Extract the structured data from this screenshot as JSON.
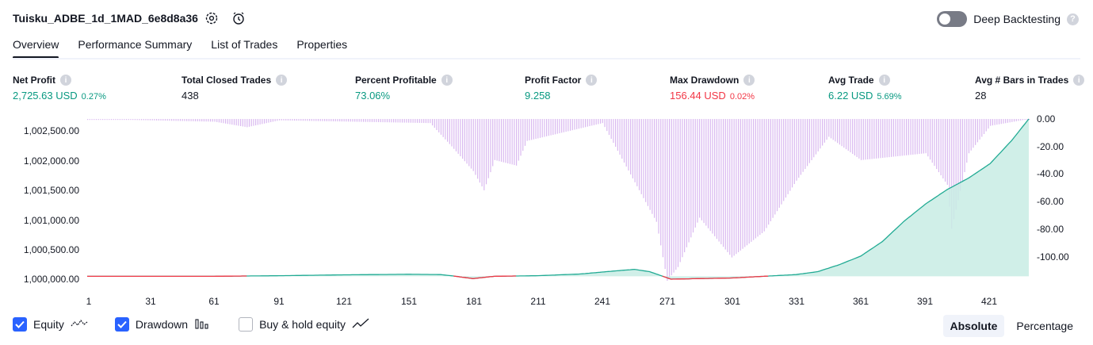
{
  "header": {
    "strategy_name": "Tuisku_ADBE_1d_1MAD_6e8d8a36",
    "deep_backtesting_label": "Deep Backtesting",
    "deep_backtesting_enabled": false
  },
  "tabs": [
    {
      "label": "Overview",
      "active": true
    },
    {
      "label": "Performance Summary",
      "active": false
    },
    {
      "label": "List of Trades",
      "active": false
    },
    {
      "label": "Properties",
      "active": false
    }
  ],
  "metrics": [
    {
      "label": "Net Profit",
      "value": "2,725.63 USD",
      "pct": "0.27%",
      "color": "green"
    },
    {
      "label": "Total Closed Trades",
      "value": "438",
      "pct": "",
      "color": "dark"
    },
    {
      "label": "Percent Profitable",
      "value": "73.06%",
      "pct": "",
      "color": "green"
    },
    {
      "label": "Profit Factor",
      "value": "9.258",
      "pct": "",
      "color": "green"
    },
    {
      "label": "Max Drawdown",
      "value": "156.44 USD",
      "pct": "0.02%",
      "color": "red"
    },
    {
      "label": "Avg Trade",
      "value": "6.22 USD",
      "pct": "5.69%",
      "color": "green"
    },
    {
      "label": "Avg # Bars in Trades",
      "value": "28",
      "pct": "",
      "color": "dark"
    }
  ],
  "chart": {
    "left_axis_labels": [
      "1,002,500.00",
      "1,002,000.00",
      "1,001,500.00",
      "1,001,000.00",
      "1,000,500.00",
      "1,000,000.00"
    ],
    "right_axis_labels": [
      "0.00",
      "-20.00",
      "-40.00",
      "-60.00",
      "-80.00",
      "-100.00"
    ],
    "x_axis_labels": [
      "1",
      "31",
      "61",
      "91",
      "121",
      "151",
      "181",
      "211",
      "241",
      "271",
      "301",
      "331",
      "361",
      "391",
      "421"
    ]
  },
  "chart_data": {
    "type": "area",
    "equity_series": {
      "name": "Equity",
      "x": [
        1,
        30,
        60,
        90,
        120,
        150,
        165,
        172,
        180,
        190,
        210,
        230,
        245,
        255,
        262,
        272,
        285,
        300,
        315,
        330,
        340,
        350,
        360,
        370,
        380,
        390,
        400,
        410,
        420,
        430,
        438
      ],
      "y": [
        1000000,
        1000000,
        1000000,
        1000010,
        1000025,
        1000035,
        1000030,
        1000000,
        999960,
        1000000,
        1000010,
        1000040,
        1000090,
        1000120,
        1000080,
        999950,
        999960,
        999970,
        1000000,
        1000030,
        1000080,
        1000200,
        1000350,
        1000600,
        1000950,
        1001250,
        1001500,
        1001700,
        1001950,
        1002350,
        1002725
      ]
    },
    "drawdown_series": {
      "name": "Drawdown",
      "x": [
        1,
        60,
        75,
        90,
        160,
        170,
        180,
        185,
        190,
        200,
        205,
        240,
        265,
        270,
        275,
        285,
        300,
        315,
        330,
        345,
        360,
        390,
        400,
        402,
        410,
        420,
        438
      ],
      "y": [
        0,
        -2,
        -6,
        -1,
        -3,
        -20,
        -38,
        -52,
        -30,
        -34,
        -16,
        -3,
        -75,
        -118,
        -108,
        -72,
        -101,
        -82,
        -45,
        -13,
        -30,
        -25,
        -48,
        -80,
        -25,
        -5,
        0
      ]
    },
    "left_ylim": [
      999950,
      1002725
    ],
    "right_ylim": [
      -118,
      0
    ],
    "xlim": [
      1,
      438
    ]
  },
  "legend": [
    {
      "label": "Equity",
      "checked": true,
      "icon": "equity-line-icon"
    },
    {
      "label": "Drawdown",
      "checked": true,
      "icon": "drawdown-bars-icon"
    },
    {
      "label": "Buy & hold equity",
      "checked": false,
      "icon": "buyhold-line-icon"
    }
  ],
  "scale_toggle": {
    "absolute": "Absolute",
    "percentage": "Percentage",
    "selected": "Absolute"
  },
  "colors": {
    "equity_line": "#22ab94",
    "equity_fill": "#c8ece4",
    "equity_below_line": "#f23645",
    "drawdown_bar": "#d9b8f0",
    "accent": "#2962ff"
  }
}
